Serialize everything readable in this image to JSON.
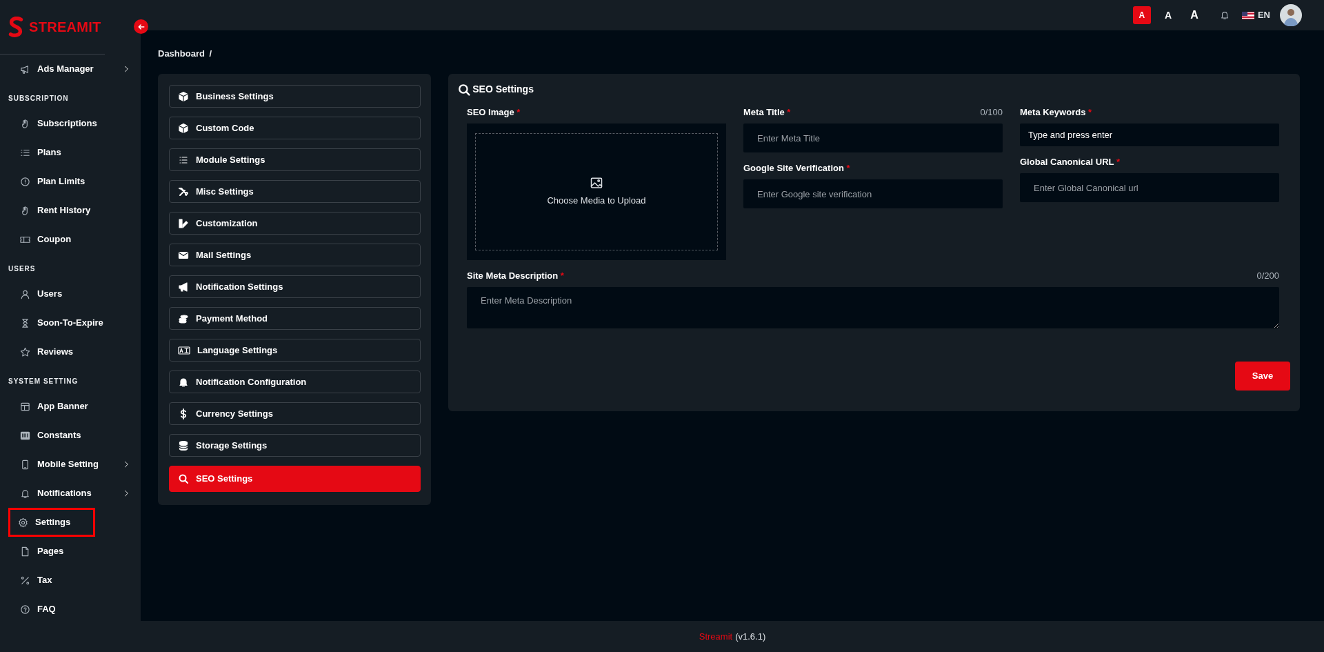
{
  "sidebar": {
    "brand": "STREAMIT",
    "groups": [
      {
        "items": [
          {
            "label": "Ads Manager",
            "has_submenu": true,
            "outlined": false
          }
        ]
      },
      {
        "heading": "SUBSCRIPTION",
        "items": [
          {
            "label": "Subscriptions",
            "has_submenu": false,
            "outlined": false
          },
          {
            "label": "Plans",
            "has_submenu": false,
            "outlined": false
          },
          {
            "label": "Plan Limits",
            "has_submenu": false,
            "outlined": false
          },
          {
            "label": "Rent History",
            "has_submenu": false,
            "outlined": false
          },
          {
            "label": "Coupon",
            "has_submenu": false,
            "outlined": false
          }
        ]
      },
      {
        "heading": "USERS",
        "items": [
          {
            "label": "Users",
            "has_submenu": false,
            "outlined": false
          },
          {
            "label": "Soon-To-Expire",
            "has_submenu": false,
            "outlined": false
          },
          {
            "label": "Reviews",
            "has_submenu": false,
            "outlined": false
          }
        ]
      },
      {
        "heading": "SYSTEM SETTING",
        "items": [
          {
            "label": "App Banner",
            "has_submenu": false,
            "outlined": false
          },
          {
            "label": "Constants",
            "has_submenu": false,
            "outlined": false
          },
          {
            "label": "Mobile Setting",
            "has_submenu": true,
            "outlined": false
          },
          {
            "label": "Notifications",
            "has_submenu": true,
            "outlined": false
          },
          {
            "label": "Settings",
            "has_submenu": false,
            "outlined": true
          },
          {
            "label": "Pages",
            "has_submenu": false,
            "outlined": false
          },
          {
            "label": "Tax",
            "has_submenu": false,
            "outlined": false
          },
          {
            "label": "FAQ",
            "has_submenu": false,
            "outlined": false
          }
        ]
      }
    ]
  },
  "topbar": {
    "font_sizes": [
      {
        "label": "A",
        "selected": true
      },
      {
        "label": "A",
        "selected": false
      },
      {
        "label": "A",
        "selected": false
      }
    ],
    "language": "EN"
  },
  "breadcrumb": {
    "items": [
      "Dashboard"
    ],
    "separator": "/"
  },
  "settings_menu": [
    {
      "label": "Business Settings",
      "selected": false
    },
    {
      "label": "Custom Code",
      "selected": false
    },
    {
      "label": "Module Settings",
      "selected": false
    },
    {
      "label": "Misc Settings",
      "selected": false
    },
    {
      "label": "Customization",
      "selected": false
    },
    {
      "label": "Mail Settings",
      "selected": false
    },
    {
      "label": "Notification Settings",
      "selected": false
    },
    {
      "label": "Payment Method",
      "selected": false
    },
    {
      "label": "Language Settings",
      "selected": false
    },
    {
      "label": "Notification Configuration",
      "selected": false
    },
    {
      "label": "Currency Settings",
      "selected": false
    },
    {
      "label": "Storage Settings",
      "selected": false
    },
    {
      "label": "SEO Settings",
      "selected": true
    }
  ],
  "form": {
    "title": "SEO Settings",
    "required_symbol": "*",
    "seo_image": {
      "label": "SEO Image",
      "required": true,
      "upload_text": "Choose Media to Upload"
    },
    "meta_title": {
      "label": "Meta Title",
      "required": true,
      "counter": "0/100",
      "placeholder": "Enter Meta Title"
    },
    "google_site_verification": {
      "label": "Google Site Verification",
      "required": true,
      "placeholder": "Enter Google site verification"
    },
    "meta_keywords": {
      "label": "Meta Keywords",
      "required": true,
      "placeholder": "Type and press enter"
    },
    "global_canonical_url": {
      "label": "Global Canonical URL",
      "required": true,
      "placeholder": "Enter Global Canonical url"
    },
    "site_meta_description": {
      "label": "Site Meta Description",
      "required": true,
      "counter": "0/200",
      "placeholder": "Enter Meta Description"
    },
    "save_button": "Save"
  },
  "footer": {
    "brand": "Streamit",
    "version": "(v1.6.1)"
  }
}
